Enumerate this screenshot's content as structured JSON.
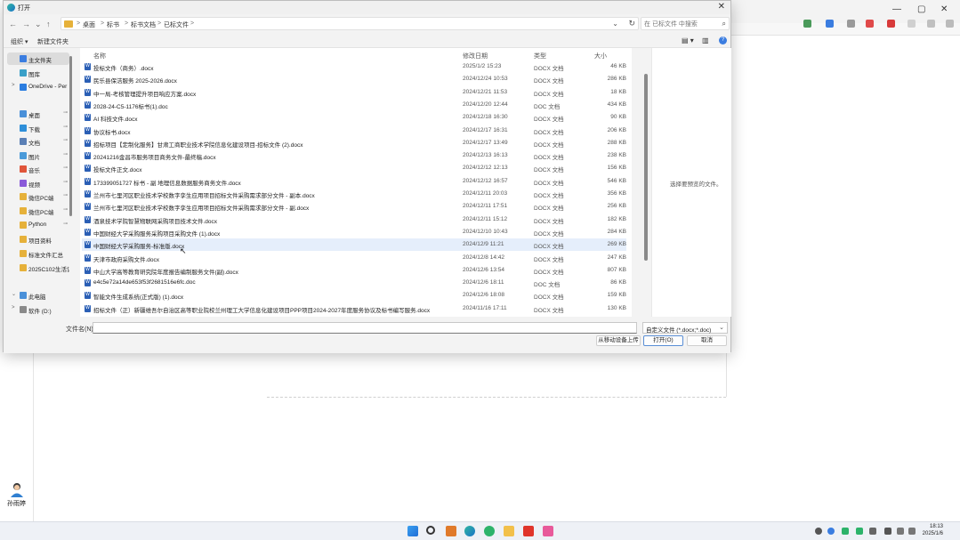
{
  "dialog": {
    "title": "打开",
    "close_glyph": "✕",
    "nav": {
      "back": "←",
      "forward": "→",
      "down": "⌄",
      "up": "↑"
    },
    "breadcrumb": [
      "桌面",
      "标书",
      "标书文档",
      "已标文件"
    ],
    "breadcrumb_sep": ">",
    "address_dropdown": "⌄",
    "refresh": "↻",
    "search_placeholder": "在 已标文件 中搜索",
    "search_icon": "⌕",
    "organize": "组织 ▾",
    "new_folder": "新建文件夹",
    "view_icons": [
      "▤ ▾",
      "▥",
      "?"
    ],
    "columns": {
      "name": "名称",
      "date": "修改日期",
      "type": "类型",
      "size": "大小"
    },
    "nav_pane": [
      {
        "label": "主文件夹",
        "icon": "home-icon",
        "selected": true,
        "pinned": false,
        "chevron": ""
      },
      {
        "label": "图库",
        "icon": "gallery-icon",
        "selected": false,
        "pinned": false,
        "chevron": ""
      },
      {
        "label": "OneDrive - Per",
        "icon": "cloud-icon",
        "selected": false,
        "pinned": false,
        "chevron": ">"
      },
      {
        "label": "桌面",
        "icon": "desktop-icon",
        "selected": false,
        "pinned": true,
        "chevron": ""
      },
      {
        "label": "下载",
        "icon": "download-icon",
        "selected": false,
        "pinned": true,
        "chevron": ""
      },
      {
        "label": "文档",
        "icon": "document-icon",
        "selected": false,
        "pinned": true,
        "chevron": ""
      },
      {
        "label": "图片",
        "icon": "picture-icon",
        "selected": false,
        "pinned": true,
        "chevron": ""
      },
      {
        "label": "音乐",
        "icon": "music-icon",
        "selected": false,
        "pinned": true,
        "chevron": ""
      },
      {
        "label": "视频",
        "icon": "video-icon",
        "selected": false,
        "pinned": true,
        "chevron": ""
      },
      {
        "label": "微信PC端",
        "icon": "folder-icon",
        "selected": false,
        "pinned": true,
        "chevron": ""
      },
      {
        "label": "微信PC端",
        "icon": "folder-icon",
        "selected": false,
        "pinned": true,
        "chevron": ""
      },
      {
        "label": "Python",
        "icon": "folder-icon",
        "selected": false,
        "pinned": true,
        "chevron": ""
      },
      {
        "label": "项目资料",
        "icon": "folder-icon",
        "selected": false,
        "pinned": false,
        "chevron": ""
      },
      {
        "label": "标准文件汇总",
        "icon": "folder-icon",
        "selected": false,
        "pinned": false,
        "chevron": ""
      },
      {
        "label": "2025C102生活记",
        "icon": "folder-icon",
        "selected": false,
        "pinned": false,
        "chevron": ""
      },
      {
        "label": "此电脑",
        "icon": "computer-icon",
        "selected": false,
        "pinned": false,
        "chevron": "⌄"
      },
      {
        "label": "软件 (D:)",
        "icon": "drive-icon",
        "selected": false,
        "pinned": false,
        "chevron": ">"
      }
    ],
    "files": [
      {
        "name": "投标文件（商务）.docx",
        "date": "2025/1/2 15:23",
        "type": "DOCX 文档",
        "size": "46 KB",
        "selected": false
      },
      {
        "name": "民乐县保洁服务 2025-2026.docx",
        "date": "2024/12/24 10:53",
        "type": "DOCX 文档",
        "size": "286 KB",
        "selected": false
      },
      {
        "name": "中一局-考核管理提升项目响应方案.docx",
        "date": "2024/12/21 11:53",
        "type": "DOCX 文档",
        "size": "18 KB",
        "selected": false
      },
      {
        "name": "2028-24-C5-1176标书(1).doc",
        "date": "2024/12/20 12:44",
        "type": "DOC 文档",
        "size": "434 KB",
        "selected": false
      },
      {
        "name": "AI 科技文件.docx",
        "date": "2024/12/18 16:30",
        "type": "DOCX 文档",
        "size": "90 KB",
        "selected": false
      },
      {
        "name": "协议标书.docx",
        "date": "2024/12/17 16:31",
        "type": "DOCX 文档",
        "size": "206 KB",
        "selected": false
      },
      {
        "name": "招标项目【定制化服务】甘肃工商职业技术学院信息化建设项目-招标文件 (2).docx",
        "date": "2024/12/17 13:49",
        "type": "DOCX 文档",
        "size": "288 KB",
        "selected": false
      },
      {
        "name": "20241216金昌市服务项目商务文件-最终稿.docx",
        "date": "2024/12/13 16:13",
        "type": "DOCX 文档",
        "size": "238 KB",
        "selected": false
      },
      {
        "name": "投标文件正文.docx",
        "date": "2024/12/12 12:13",
        "type": "DOCX 文档",
        "size": "156 KB",
        "selected": false
      },
      {
        "name": "173399051727 标书 - 副 地理信息数据服务商务文件.docx",
        "date": "2024/12/12 16:57",
        "type": "DOCX 文档",
        "size": "546 KB",
        "selected": false
      },
      {
        "name": "兰州市七里河区职业技术学校数字孪生应用项目招标文件采购需求部分文件 - 副本.docx",
        "date": "2024/12/11 20:03",
        "type": "DOCX 文档",
        "size": "356 KB",
        "selected": false
      },
      {
        "name": "兰州市七里河区职业技术学校数字孪生应用项目招标文件采购需求部分文件 - 副.docx",
        "date": "2024/12/11 17:51",
        "type": "DOCX 文档",
        "size": "256 KB",
        "selected": false
      },
      {
        "name": "酒泉技术学院智慧物联网采购项目技术文件.docx",
        "date": "2024/12/11 15:12",
        "type": "DOCX 文档",
        "size": "182 KB",
        "selected": false
      },
      {
        "name": "中国财经大学采购服务采购项目采购文件 (1).docx",
        "date": "2024/12/10 10:43",
        "type": "DOCX 文档",
        "size": "284 KB",
        "selected": false
      },
      {
        "name": "中国财经大学采购服务-标准版.docx",
        "date": "2024/12/9 11:21",
        "type": "DOCX 文档",
        "size": "269 KB",
        "selected": true
      },
      {
        "name": "天津市政府采购文件.docx",
        "date": "2024/12/8 14:42",
        "type": "DOCX 文档",
        "size": "247 KB",
        "selected": false
      },
      {
        "name": "中山大学高等教育研究院年度报告编制服务文件(副).docx",
        "date": "2024/12/6 13:54",
        "type": "DOCX 文档",
        "size": "807 KB",
        "selected": false
      },
      {
        "name": "e4c5e72a14de653f53f2681516e6fc.doc",
        "date": "2024/12/6 18:11",
        "type": "DOC 文档",
        "size": "86 KB",
        "selected": false
      },
      {
        "name": "智能文件生成系统(正式版) (1).docx",
        "date": "2024/12/6 18:08",
        "type": "DOCX 文档",
        "size": "159 KB",
        "selected": false
      },
      {
        "name": "招标文件（正）新疆维吾尔自治区高等职业院校兰州理工大学信息化建设项目PPP项目2024-2027年度服务协议及标书编写服务.docx",
        "date": "2024/11/16 17:11",
        "type": "DOCX 文档",
        "size": "130 KB",
        "selected": false
      }
    ],
    "preview_text": "选择要预览的文件。",
    "filename_label": "文件名(N):",
    "filename_value": "",
    "filter_value": "自定义文件 (*.docx;*.doc)",
    "filter_chevron": "⌄",
    "buttons": {
      "upload": "从移动设备上传",
      "open": "打开(O)",
      "cancel": "取消"
    }
  },
  "background": {
    "window_controls": [
      "—",
      "▢",
      "✕"
    ]
  },
  "user": {
    "name": "孙雨婷"
  },
  "taskbar": {
    "clock_time": "18:13",
    "clock_date": "2025/1/6"
  }
}
